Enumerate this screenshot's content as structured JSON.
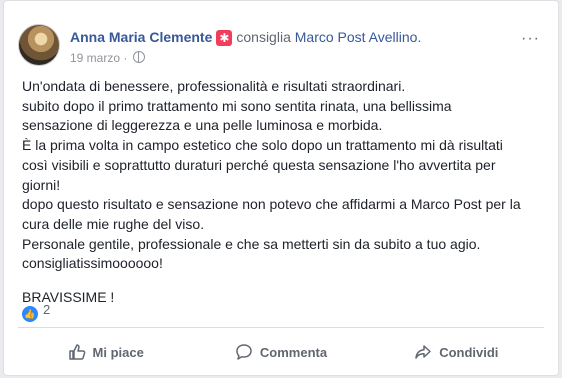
{
  "post": {
    "author": "Anna Maria Clemente",
    "verb": "consiglia",
    "page_name": "Marco Post Avellino.",
    "date": "19 marzo",
    "separator": "·",
    "menu": "···",
    "lines": [
      "Un'ondata di benessere, professionalità e risultati straordinari.",
      "subito dopo il primo trattamento mi sono sentita rinata, una bellissima",
      "sensazione di leggerezza e una pelle luminosa e morbida.",
      "È la prima volta in campo estetico che solo dopo un trattamento mi dà risultati",
      "così visibili e soprattutto duraturi perché questa sensazione l'ho avvertita per",
      "giorni!",
      "dopo questo risultato e sensazione non potevo che affidarmi a Marco Post per la",
      "cura delle mie rughe del viso.",
      "Personale gentile, professionale e che sa metterti sin da subito a tuo agio.",
      "consigliatissimoooooo!"
    ],
    "closing": "BRAVISSIME !"
  },
  "reactions": {
    "count": "2"
  },
  "actions": {
    "like": "Mi piace",
    "comment": "Commenta",
    "share": "Condividi"
  },
  "colors": {
    "link": "#385898",
    "text": "#1d2129",
    "muted": "#606770",
    "badge": "#f03d5b",
    "like": "#2d88ff"
  }
}
